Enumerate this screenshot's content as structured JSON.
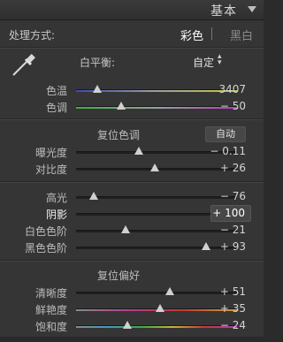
{
  "header": {
    "title": "基本"
  },
  "treatment": {
    "label": "处理方式:",
    "color": "彩色",
    "bw": "黑白"
  },
  "white_balance": {
    "label": "白平衡:",
    "value": "自定"
  },
  "wb_sliders": [
    {
      "label": "色温",
      "value": "3407",
      "position": 0.13
    },
    {
      "label": "色调",
      "value": "− 50",
      "position": 0.28
    }
  ],
  "tone": {
    "heading": "复位色调",
    "auto": "自动"
  },
  "tone_sliders": [
    {
      "label": "曝光度",
      "value": "− 0.11",
      "position": 0.39
    },
    {
      "label": "对比度",
      "value": "+ 26",
      "position": 0.49
    },
    {
      "label": "高光",
      "value": "− 76",
      "position": 0.11
    },
    {
      "label": "阴影",
      "value": "+ 100",
      "position": 0.92
    },
    {
      "label": "白色色阶",
      "value": "− 21",
      "position": 0.31
    },
    {
      "label": "黑色色阶",
      "value": "+ 93",
      "position": 0.81
    }
  ],
  "presence": {
    "heading": "复位偏好"
  },
  "presence_sliders": [
    {
      "label": "清晰度",
      "value": "+ 51",
      "position": 0.58
    },
    {
      "label": "鲜艳度",
      "value": "+ 35",
      "position": 0.52
    },
    {
      "label": "饱和度",
      "value": "− 24",
      "position": 0.32
    }
  ]
}
